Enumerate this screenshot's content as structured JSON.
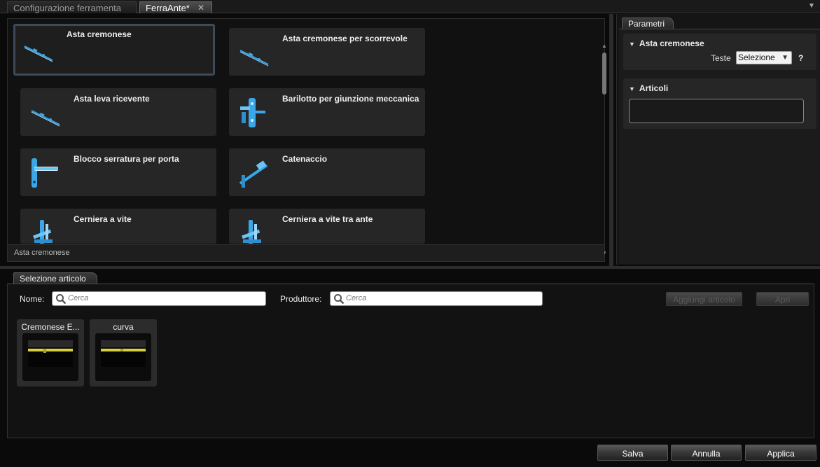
{
  "tabs": [
    {
      "label": "Configurazione ferramenta",
      "active": false
    },
    {
      "label": "FerraAnte*",
      "active": true
    }
  ],
  "catalog": {
    "items": [
      {
        "label": "Asta cremonese",
        "icon": "rod-icon",
        "selected": true
      },
      {
        "label": "Asta cremonese per scorrevole",
        "icon": "rod-icon"
      },
      {
        "label": "Asta leva ricevente",
        "icon": "rod-icon"
      },
      {
        "label": "Barilotto per giunzione meccanica",
        "icon": "hinge-barrel-icon"
      },
      {
        "label": "Blocco serratura per porta",
        "icon": "door-handle-icon"
      },
      {
        "label": "Catenaccio",
        "icon": "bolt-icon"
      },
      {
        "label": "Cerniera a vite",
        "icon": "screw-hinge-icon"
      },
      {
        "label": "Cerniera a vite tra ante",
        "icon": "screw-hinge-icon"
      }
    ],
    "status": "Asta cremonese"
  },
  "params": {
    "tab_label": "Parametri",
    "section1": {
      "title": "Asta cremonese",
      "teste_label": "Teste",
      "teste_value": "Selezione",
      "help": "?"
    },
    "section2": {
      "title": "Articoli"
    }
  },
  "selection": {
    "tab_label": "Selezione articolo",
    "nome_label": "Nome:",
    "nome_placeholder": "Cerca",
    "produttore_label": "Produttore:",
    "produttore_placeholder": "Cerca",
    "add_button": "Aggiungi articolo",
    "open_button": "Apri",
    "articles": [
      {
        "name": "Cremonese E..."
      },
      {
        "name": "curva"
      }
    ]
  },
  "footer": {
    "save": "Salva",
    "cancel": "Annulla",
    "apply": "Applica"
  },
  "colors": {
    "accent_blue": "#3aa7e8",
    "preview_yellow": "#d8d040",
    "selected_border": "#3d4a5a"
  }
}
